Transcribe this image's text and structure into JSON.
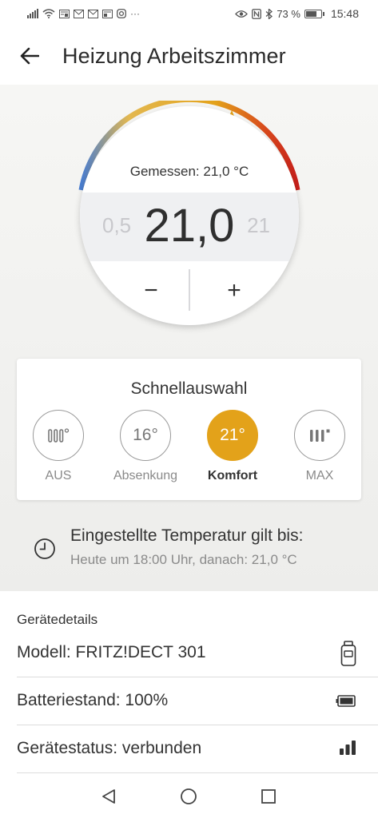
{
  "status_bar": {
    "battery_percent": "73 %",
    "time": "15:48",
    "battery_level": 0.73
  },
  "header": {
    "title": "Heizung Arbeitszimmer"
  },
  "thermostat": {
    "measured_label": "Gemessen: 21,0 °C",
    "set_temperature": "21,0",
    "prev_value": "0,5",
    "next_value": "21",
    "minus_label": "−",
    "plus_label": "+",
    "arc_colors": {
      "cold": "#4a7ed1",
      "mid": "#e3b850",
      "hot": "#c8201b"
    }
  },
  "quick_select": {
    "title": "Schnellauswahl",
    "items": [
      {
        "value": "",
        "label": "AUS",
        "icon": "radiator-off-icon",
        "active": false
      },
      {
        "value": "16°",
        "label": "Absenkung",
        "active": false
      },
      {
        "value": "21°",
        "label": "Komfort",
        "active": true
      },
      {
        "value": "",
        "label": "MAX",
        "icon": "radiator-max-icon",
        "active": false
      }
    ],
    "accent_color": "#e3a21a"
  },
  "schedule_info": {
    "title": "Eingestellte Temperatur gilt bis:",
    "subtitle": "Heute um 18:00 Uhr, danach: 21,0 °C"
  },
  "device_details": {
    "heading": "Gerätedetails",
    "rows": [
      {
        "text": "Modell: FRITZ!DECT 301",
        "icon": "device-icon"
      },
      {
        "text": "Batteriestand: 100%",
        "icon": "battery-icon"
      },
      {
        "text": "Gerätestatus: verbunden",
        "icon": "signal-icon"
      }
    ]
  }
}
